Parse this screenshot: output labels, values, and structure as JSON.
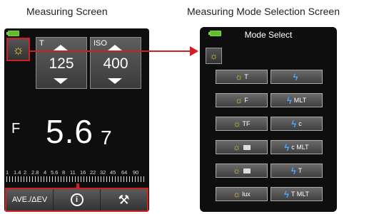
{
  "captions": {
    "left": "Measuring Screen",
    "right": "Measuring Mode Selection Screen"
  },
  "accent_color": "#d21f26",
  "measuring_screen": {
    "mode_icon": "sun-icon",
    "shutter": {
      "label": "T",
      "value": "125"
    },
    "iso": {
      "label": "ISO",
      "value": "400"
    },
    "aperture_label": "F",
    "aperture_value": "5.6",
    "aperture_tenths": "7",
    "scale_labels": [
      "1",
      "1.4",
      "2",
      "2.8",
      "4",
      "5.6",
      "8",
      "11",
      "16",
      "22",
      "32",
      "45",
      "64",
      "90"
    ],
    "bottom_buttons": [
      "AVE./ΔEV",
      "memory-icon",
      "wrench-icon"
    ]
  },
  "mode_screen": {
    "title": "Mode Select",
    "buttons": [
      {
        "icon": "sun-icon",
        "label": "T"
      },
      {
        "icon": "flash-icon",
        "label": ""
      },
      {
        "icon": "sun-icon",
        "label": "F"
      },
      {
        "icon": "flash-icon",
        "label": "MLT"
      },
      {
        "icon": "sun-icon",
        "label": "TF"
      },
      {
        "icon": "flash-icon",
        "label": "c"
      },
      {
        "icon": "sun-icon",
        "label": ""
      },
      {
        "icon": "flash-icon",
        "label": "c MLT"
      },
      {
        "icon": "sun-icon",
        "label": ""
      },
      {
        "icon": "flash-icon",
        "label": "T"
      },
      {
        "icon": "sun-icon",
        "label": "lux"
      },
      {
        "icon": "flash-icon",
        "label": "T MLT"
      }
    ]
  }
}
